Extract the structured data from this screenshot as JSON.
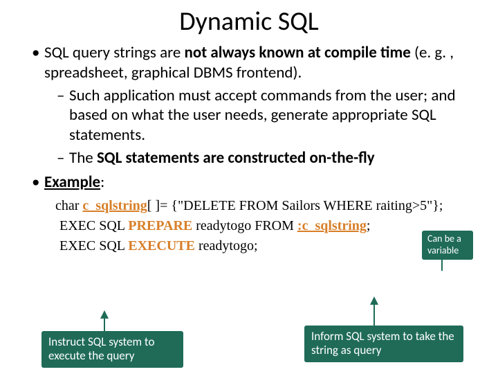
{
  "title": "Dynamic SQL",
  "bullet1_a": "SQL query strings are ",
  "bullet1_b": "not always known at compile time",
  "bullet1_c": " (e. g. , spreadsheet, graphical DBMS frontend).",
  "sub1": "Such application must accept commands from the user; and based on what the user needs, generate appropriate SQL statements.",
  "sub2_a": "The ",
  "sub2_b": "SQL statements are constructed on-the-fly",
  "example_label": "Example",
  "example_colon": ":",
  "code": {
    "l1_a": "char ",
    "l1_b": "c_sqlstring",
    "l1_c": "[ ]= {\"DELETE FROM Sailors WHERE raiting>5\"};",
    "l2_a": "EXEC  SQL ",
    "l2_b": "PREPARE",
    "l2_c": " readytogo FROM ",
    "l2_d": ":c_sqlstring",
    "l2_e": ";",
    "l3_a": "EXEC  SQL ",
    "l3_b": "EXECUTE",
    "l3_c": " readytogo;"
  },
  "callouts": {
    "canbe": "Can be a variable",
    "instruct": "Instruct SQL system to execute the query",
    "inform": "Inform SQL system to take the string as query"
  }
}
